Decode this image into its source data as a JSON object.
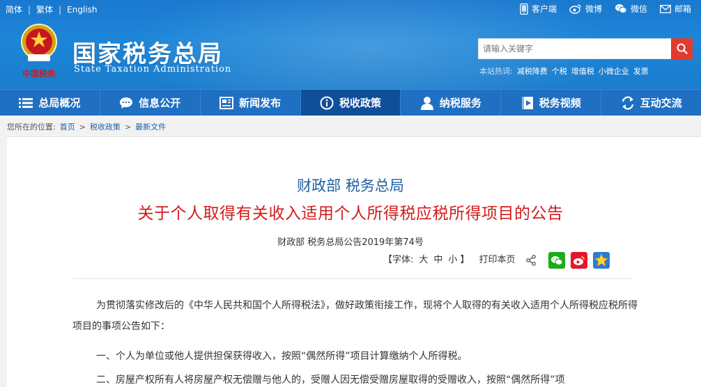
{
  "lang": {
    "simplified": "简体",
    "traditional": "繁体",
    "english": "English"
  },
  "quick_links": {
    "client": "客户端",
    "weibo": "微博",
    "wechat": "微信",
    "mail": "邮箱"
  },
  "site": {
    "title": "国家税务总局",
    "title_en": "State Taxation Administration",
    "emblem_caption": "中国税务"
  },
  "search": {
    "placeholder": "请输入关键字"
  },
  "hotwords": {
    "label": "本站热词:",
    "words": [
      "减税降费",
      "个税",
      "增值税",
      "小微企业",
      "发票"
    ]
  },
  "nav": [
    {
      "label": "总局概况",
      "icon": "list-icon"
    },
    {
      "label": "信息公开",
      "icon": "chat-icon"
    },
    {
      "label": "新闻发布",
      "icon": "newspaper-icon"
    },
    {
      "label": "税收政策",
      "icon": "info-icon",
      "active": true
    },
    {
      "label": "纳税服务",
      "icon": "user-icon"
    },
    {
      "label": "税务视频",
      "icon": "video-icon"
    },
    {
      "label": "互动交流",
      "icon": "exchange-icon"
    }
  ],
  "breadcrumb": {
    "prefix": "您所在的位置:",
    "items": [
      "首页",
      "税收政策",
      "最新文件"
    ],
    "separator": ">"
  },
  "doc": {
    "issuer": "财政部 税务总局",
    "title": "关于个人取得有关收入适用个人所得税应税所得项目的公告",
    "number": "财政部 税务总局公告2019年第74号",
    "font_label": "【字体:",
    "font_sizes": [
      "大",
      "中",
      "小"
    ],
    "font_close": "】",
    "print": "打印本页",
    "paragraphs": [
      "为贯彻落实修改后的《中华人民共和国个人所得税法》，做好政策衔接工作，现将个人取得的有关收入适用个人所得税应税所得项目的事项公告如下：",
      "一、个人为单位或他人提供担保获得收入，按照“偶然所得”项目计算缴纳个人所得税。",
      "二、房屋产权所有人将房屋产权无偿赠与他人的，受赠人因无偿受赠房屋取得的受赠收入，按照“偶然所得”项"
    ]
  },
  "colors": {
    "header_blue": "#1d86d8",
    "nav_blue": "#1f6fc3",
    "nav_active": "#0f4f9a",
    "title_red": "#d21b1b",
    "issuer_blue": "#1f5fa6",
    "search_red": "#e23b2e",
    "wechat_green": "#1aad19",
    "weibo_red": "#e6162d",
    "qzone_blue": "#2b7bd6"
  }
}
